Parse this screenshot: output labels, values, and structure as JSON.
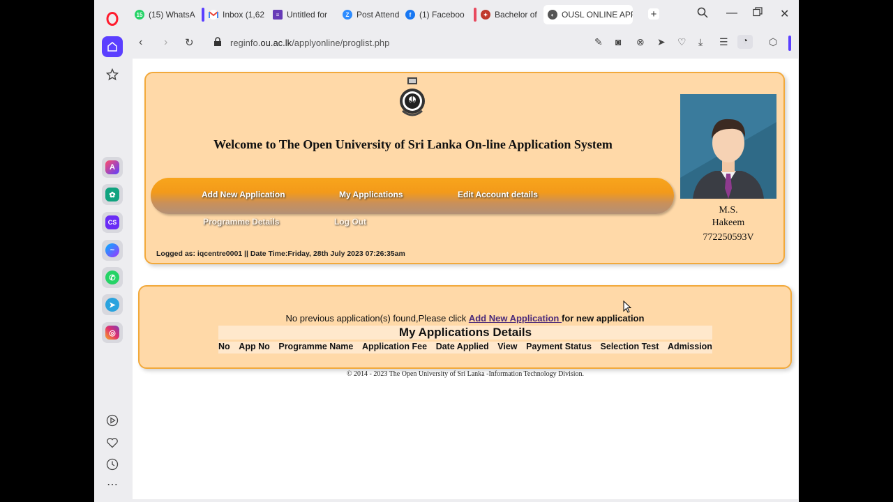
{
  "browser": {
    "tabs": [
      {
        "label": "(15) WhatsA",
        "icon": "whatsapp-icon",
        "color": "#25d366",
        "badge": "15"
      },
      {
        "label": "Inbox (1,62",
        "icon": "gmail-icon",
        "color": "#ea4335"
      },
      {
        "label": "Untitled for",
        "icon": "forms-icon",
        "color": "#673ab7"
      },
      {
        "label": "Post Attend",
        "icon": "zoom-icon",
        "color": "#2d8cff"
      },
      {
        "label": "(1) Faceboo",
        "icon": "facebook-icon",
        "color": "#1877f2"
      },
      {
        "label": "Bachelor of",
        "icon": "university-icon",
        "color": "#c0392b"
      },
      {
        "label": "OUSL ONLINE APPL",
        "icon": "globe-icon",
        "color": "#555555"
      }
    ],
    "url_prefix": "reginfo.",
    "url_domain": "ou.ac.lk",
    "url_path": "/applyonline/proglist.php"
  },
  "header": {
    "welcome": "Welcome to The Open University of Sri Lanka On-line Application System",
    "menu": {
      "add_new": "Add New Application",
      "my_apps": "My Applications",
      "edit_account": "Edit Account details",
      "programme_details": "Programme Details",
      "logout": "Log Out"
    },
    "logged": "Logged as: iqcentre0001 || Date Time:Friday, 28th July 2023 07:26:35am",
    "profile": {
      "name_line1": "M.S.",
      "name_line2": "Hakeem",
      "nic": "772250593V"
    }
  },
  "applications": {
    "notice_prefix": "No previous application(s) found,Please click ",
    "notice_link": "Add New Application ",
    "notice_suffix": "for new application",
    "title": "My Applications Details",
    "columns": [
      "No",
      "App No",
      "Programme Name",
      "Application Fee",
      "Date Applied",
      "View",
      "Payment Status",
      "Selection Test",
      "Admission"
    ]
  },
  "footer": "© 2014 - 2023 The Open University of Sri Lanka -Information Technology Division.",
  "colors": {
    "panel_bg": "#ffd9a8",
    "panel_border": "#f2a93b",
    "menu_orange": "#f8a51c",
    "opera_red": "#ff1b2d",
    "opera_home": "#5b3fff"
  }
}
